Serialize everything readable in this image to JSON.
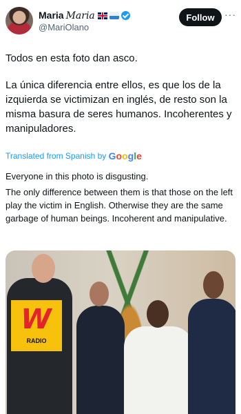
{
  "author": {
    "name": "Maria",
    "display_suffix": "Maria",
    "handle": "@MariOlano",
    "flag_icon": "uk-flag-icon",
    "wave_icon": "wave-icon",
    "verified_icon": "verified-badge-icon"
  },
  "actions": {
    "follow_label": "Follow",
    "more_label": "···"
  },
  "tweet": {
    "paragraphs": [
      "Todos en esta foto dan asco.",
      "La única diferencia entre ellos, es que los de la izquierda se victimizan en inglés, de resto son la misma basura de seres humanos. Incoherentes y manipuladores."
    ]
  },
  "translation": {
    "label": "Translated from Spanish by",
    "provider": "Google",
    "paragraphs": [
      "Everyone in this photo is disgusting.",
      "The only difference between them is that those on the left play the victim in English. Otherwise they are the same garbage of human beings. Incoherent and manipulative."
    ]
  },
  "media": {
    "logo_mark": "W",
    "logo_text": "RADIO"
  },
  "colors": {
    "link": "#1d9bf0",
    "follow_bg": "#0f1419",
    "logo_yellow": "#f7c10c",
    "logo_red": "#e3242b"
  }
}
